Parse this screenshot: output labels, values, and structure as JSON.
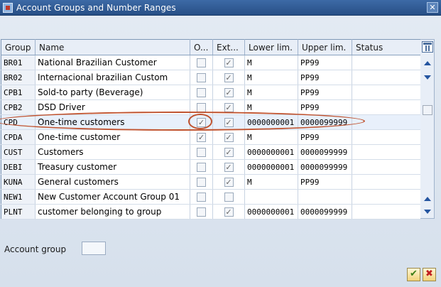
{
  "window": {
    "title": "Account Groups and Number Ranges"
  },
  "grid": {
    "columns": [
      "Group",
      "Name",
      "O...",
      "Ext...",
      "Lower lim.",
      "Upper lim.",
      "Status"
    ],
    "rows": [
      {
        "group": "BR01",
        "name": "National  Brazilian Customer",
        "o": false,
        "ext": true,
        "lower": "M",
        "upper": "PP99",
        "status": ""
      },
      {
        "group": "BR02",
        "name": "Internacional brazilian Custom",
        "o": false,
        "ext": true,
        "lower": "M",
        "upper": "PP99",
        "status": ""
      },
      {
        "group": "CPB1",
        "name": "Sold-to party (Beverage)",
        "o": false,
        "ext": true,
        "lower": "M",
        "upper": "PP99",
        "status": ""
      },
      {
        "group": "CPB2",
        "name": "DSD Driver",
        "o": false,
        "ext": true,
        "lower": "M",
        "upper": "PP99",
        "status": ""
      },
      {
        "group": "CPD",
        "name": "One-time customers",
        "o": true,
        "ext": true,
        "lower": "0000000001",
        "upper": "0000099999",
        "status": ""
      },
      {
        "group": "CPDA",
        "name": "One-time customer",
        "o": true,
        "ext": true,
        "lower": "M",
        "upper": "PP99",
        "status": ""
      },
      {
        "group": "CUST",
        "name": "Customers",
        "o": false,
        "ext": true,
        "lower": "0000000001",
        "upper": "0000099999",
        "status": ""
      },
      {
        "group": "DEBI",
        "name": "Treasury customer",
        "o": false,
        "ext": true,
        "lower": "0000000001",
        "upper": "0000099999",
        "status": ""
      },
      {
        "group": "KUNA",
        "name": "General customers",
        "o": false,
        "ext": true,
        "lower": "M",
        "upper": "PP99",
        "status": ""
      },
      {
        "group": "NEW1",
        "name": "New Customer Account Group 01",
        "o": false,
        "ext": false,
        "lower": "",
        "upper": "",
        "status": ""
      },
      {
        "group": "PLNT",
        "name": "customer belonging to group",
        "o": false,
        "ext": true,
        "lower": "0000000001",
        "upper": "0000099999",
        "status": ""
      }
    ]
  },
  "filter": {
    "label": "Account group",
    "value": ""
  },
  "icons": {
    "close": "close-icon",
    "settings": "table-settings-icon",
    "ok": "checkmark-icon",
    "cancel": "cancel-icon"
  },
  "colors": {
    "titlebar": "#274f86",
    "highlight": "#c0532f"
  }
}
